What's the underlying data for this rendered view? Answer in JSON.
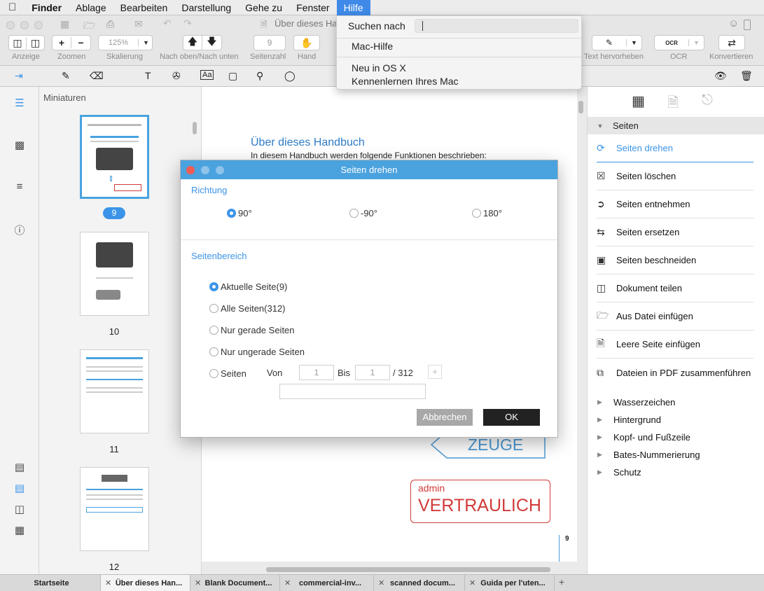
{
  "menubar": {
    "apple": "",
    "items": [
      "Finder",
      "Ablage",
      "Bearbeiten",
      "Darstellung",
      "Gehe zu",
      "Fenster",
      "Hilfe"
    ]
  },
  "window": {
    "title": "Über dieses Ha"
  },
  "toolbar": {
    "zoom_value": "125%",
    "page_number": "9",
    "labels": {
      "anzeige": "Anzeige",
      "zoomen": "Zoomen",
      "skalierung": "Skalierung",
      "nav": "Nach oben/Nach unten",
      "seitenzahl": "Seitenzahl",
      "hand": "Hand",
      "text_hervorheben": "Text hervorheben",
      "ocr": "OCR",
      "konvertieren": "Konvertieren"
    },
    "zoom_plus": "+",
    "zoom_minus": "−",
    "ocr_badge": "OCR"
  },
  "help_menu": {
    "search_label": "Suchen nach",
    "search_value": "",
    "items": [
      "Mac-Hilfe",
      "Neu in OS X",
      "Kennenlernen Ihres Mac"
    ]
  },
  "thumbs": {
    "header": "Miniaturen",
    "pages": [
      "9",
      "10",
      "11",
      "12"
    ]
  },
  "document": {
    "heading": "Über dieses Handbuch",
    "line1": "In diesem Handbuch werden folgende Funktionen beschrieben:",
    "stamp_zeuge": "ZEUGE",
    "stamp_admin": "admin",
    "stamp_vertraulich": "VERTRAULICH",
    "page_number": "9"
  },
  "dialog": {
    "title": "Seiten drehen",
    "richtung_label": "Richtung",
    "angles": [
      "90°",
      "-90°",
      "180°"
    ],
    "selected_angle": "90°",
    "bereich_label": "Seitenbereich",
    "range_options": [
      "Aktuelle Seite(9)",
      "Alle Seiten(312)",
      "Nur gerade Seiten",
      "Nur ungerade Seiten",
      "Seiten"
    ],
    "selected_range": "Aktuelle Seite(9)",
    "von_label": "Von",
    "von_value": "1",
    "bis_label": "Bis",
    "bis_value": "1",
    "total": "/ 312",
    "plus": "+",
    "cancel_label": "Abbrechen",
    "ok_label": "OK"
  },
  "right_panel": {
    "section": "Seiten",
    "items": [
      {
        "label": "Seiten drehen",
        "icon": "rotate-icon"
      },
      {
        "label": "Seiten löschen",
        "icon": "page-delete-icon"
      },
      {
        "label": "Seiten entnehmen",
        "icon": "page-extract-icon"
      },
      {
        "label": "Seiten ersetzen",
        "icon": "page-replace-icon"
      },
      {
        "label": "Seiten beschneiden",
        "icon": "crop-icon"
      },
      {
        "label": "Dokument teilen",
        "icon": "split-icon"
      },
      {
        "label": "Aus Datei einfügen",
        "icon": "folder-icon"
      },
      {
        "label": "Leere Seite einfügen",
        "icon": "blank-page-icon"
      },
      {
        "label": "Dateien in PDF zusammenführen",
        "icon": "merge-icon"
      }
    ],
    "subsections": [
      "Wasserzeichen",
      "Hintergrund",
      "Kopf- und Fußzeile",
      "Bates-Nummerierung",
      "Schutz"
    ]
  },
  "tabs": [
    "Startseite",
    "Über dieses Han...",
    "Blank Document...",
    "commercial-inv...",
    "scanned docum...",
    "Guida per l'uten..."
  ],
  "tab_add": "+",
  "colors": {
    "accent": "#3b94e8",
    "dialog_title": "#4aa2de",
    "stamp_red": "#d23a3a",
    "stamp_blue": "#4a9ad6"
  }
}
